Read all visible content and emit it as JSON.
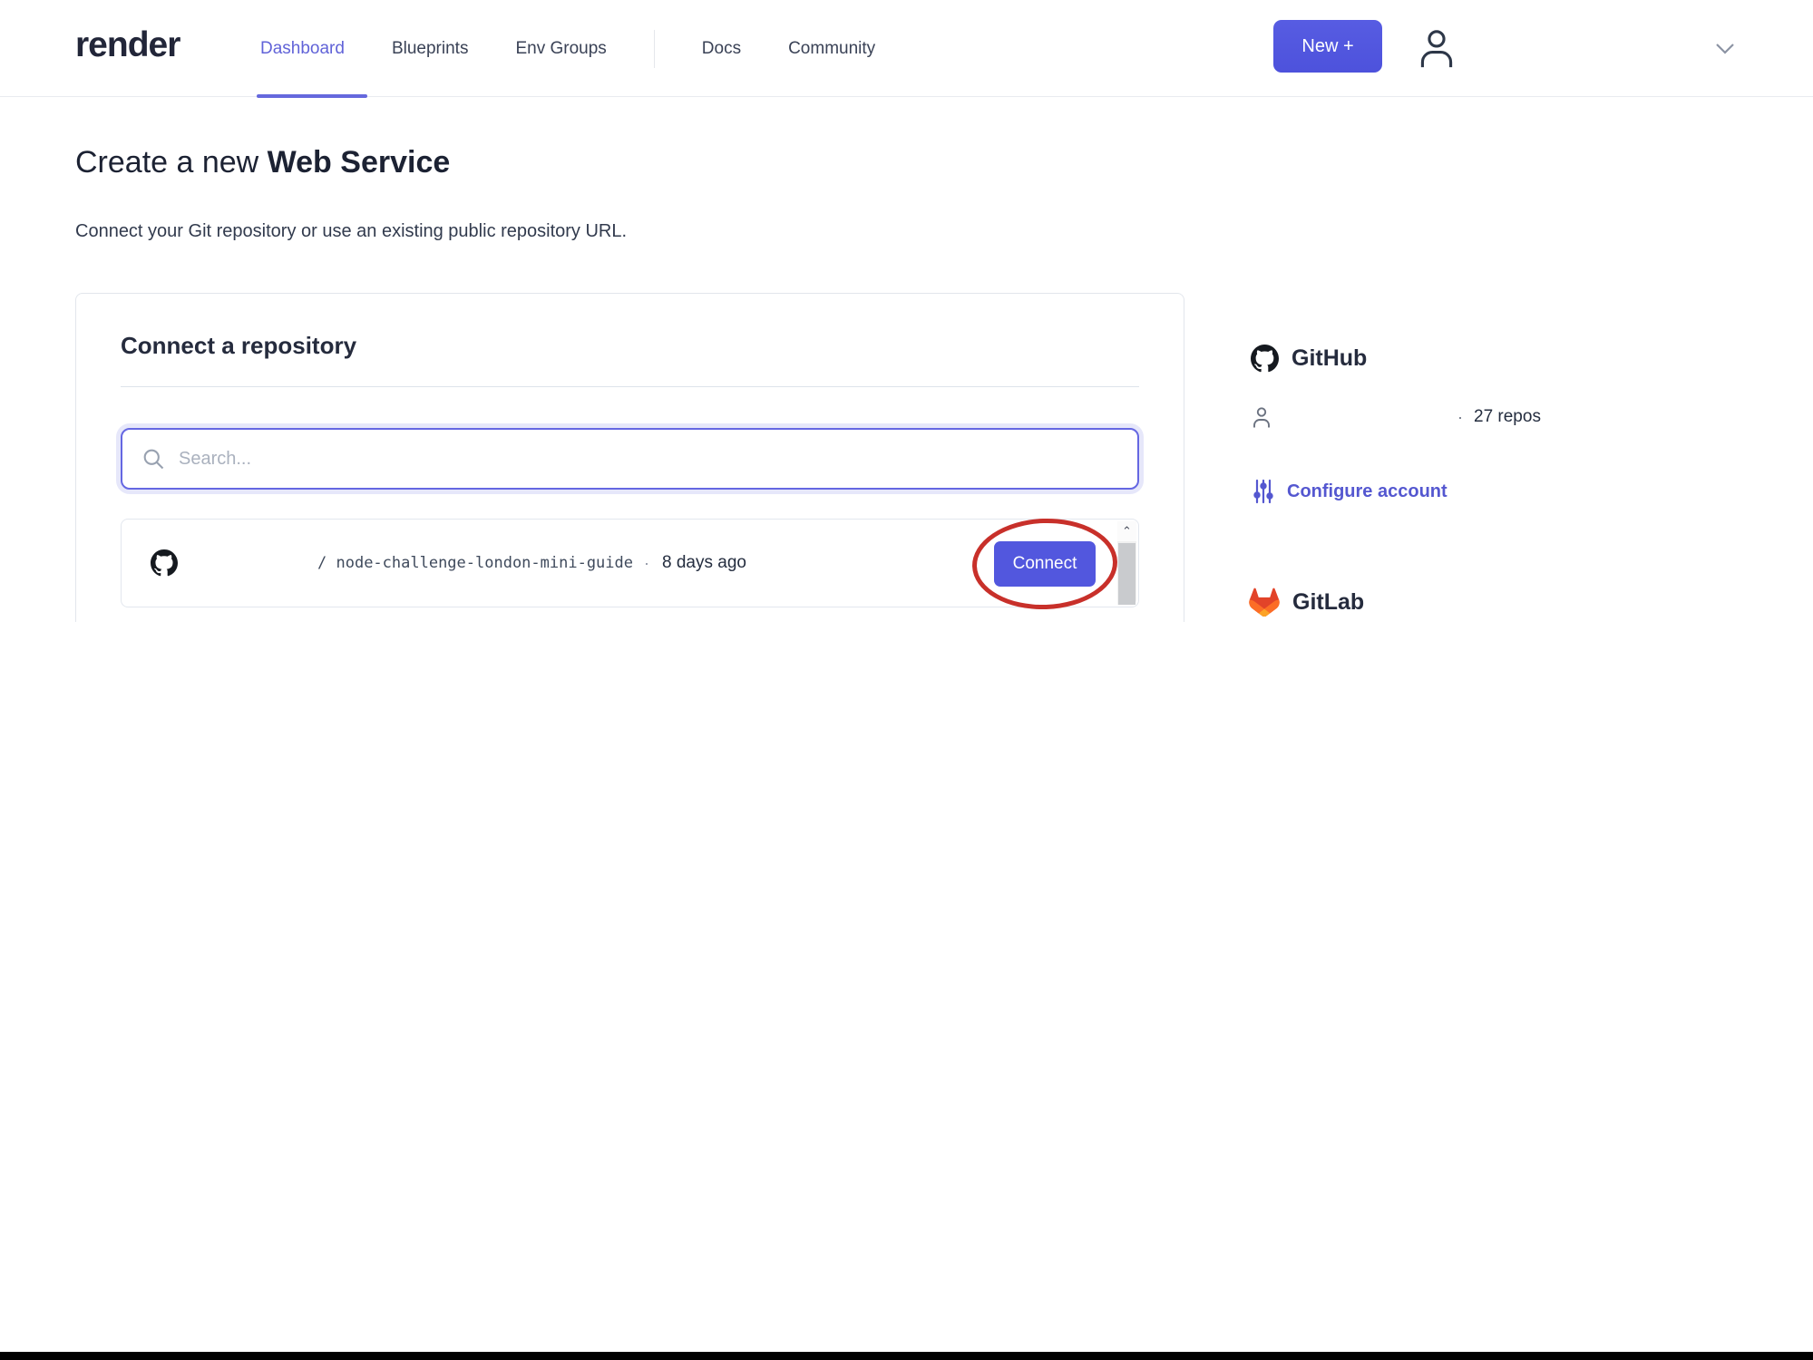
{
  "nav": {
    "logo": "render",
    "items": [
      {
        "label": "Dashboard",
        "active": true
      },
      {
        "label": "Blueprints",
        "active": false
      },
      {
        "label": "Env Groups",
        "active": false
      },
      {
        "label": "Docs",
        "active": false
      },
      {
        "label": "Community",
        "active": false
      }
    ],
    "new_button_label": "New +"
  },
  "page": {
    "title_prefix": "Create a new ",
    "title_emphasis": "Web Service",
    "subtitle": "Connect your Git repository or use an existing public repository URL."
  },
  "card": {
    "heading": "Connect a repository",
    "search_placeholder": "Search...",
    "repo": {
      "path_prefix": "/ ",
      "name": "node-challenge-london-mini-guide",
      "separator": "·",
      "updated": "8 days ago",
      "connect_label": "Connect"
    },
    "scroll_up_glyph": "⌃"
  },
  "sidebar": {
    "github": {
      "title": "GitHub",
      "separator": "·",
      "repo_count": "27 repos",
      "configure_label": "Configure account"
    },
    "gitlab": {
      "title": "GitLab"
    }
  },
  "colors": {
    "accent": "#5558E0",
    "annotation_red": "#C8302A",
    "gitlab_orange": "#E24329"
  }
}
